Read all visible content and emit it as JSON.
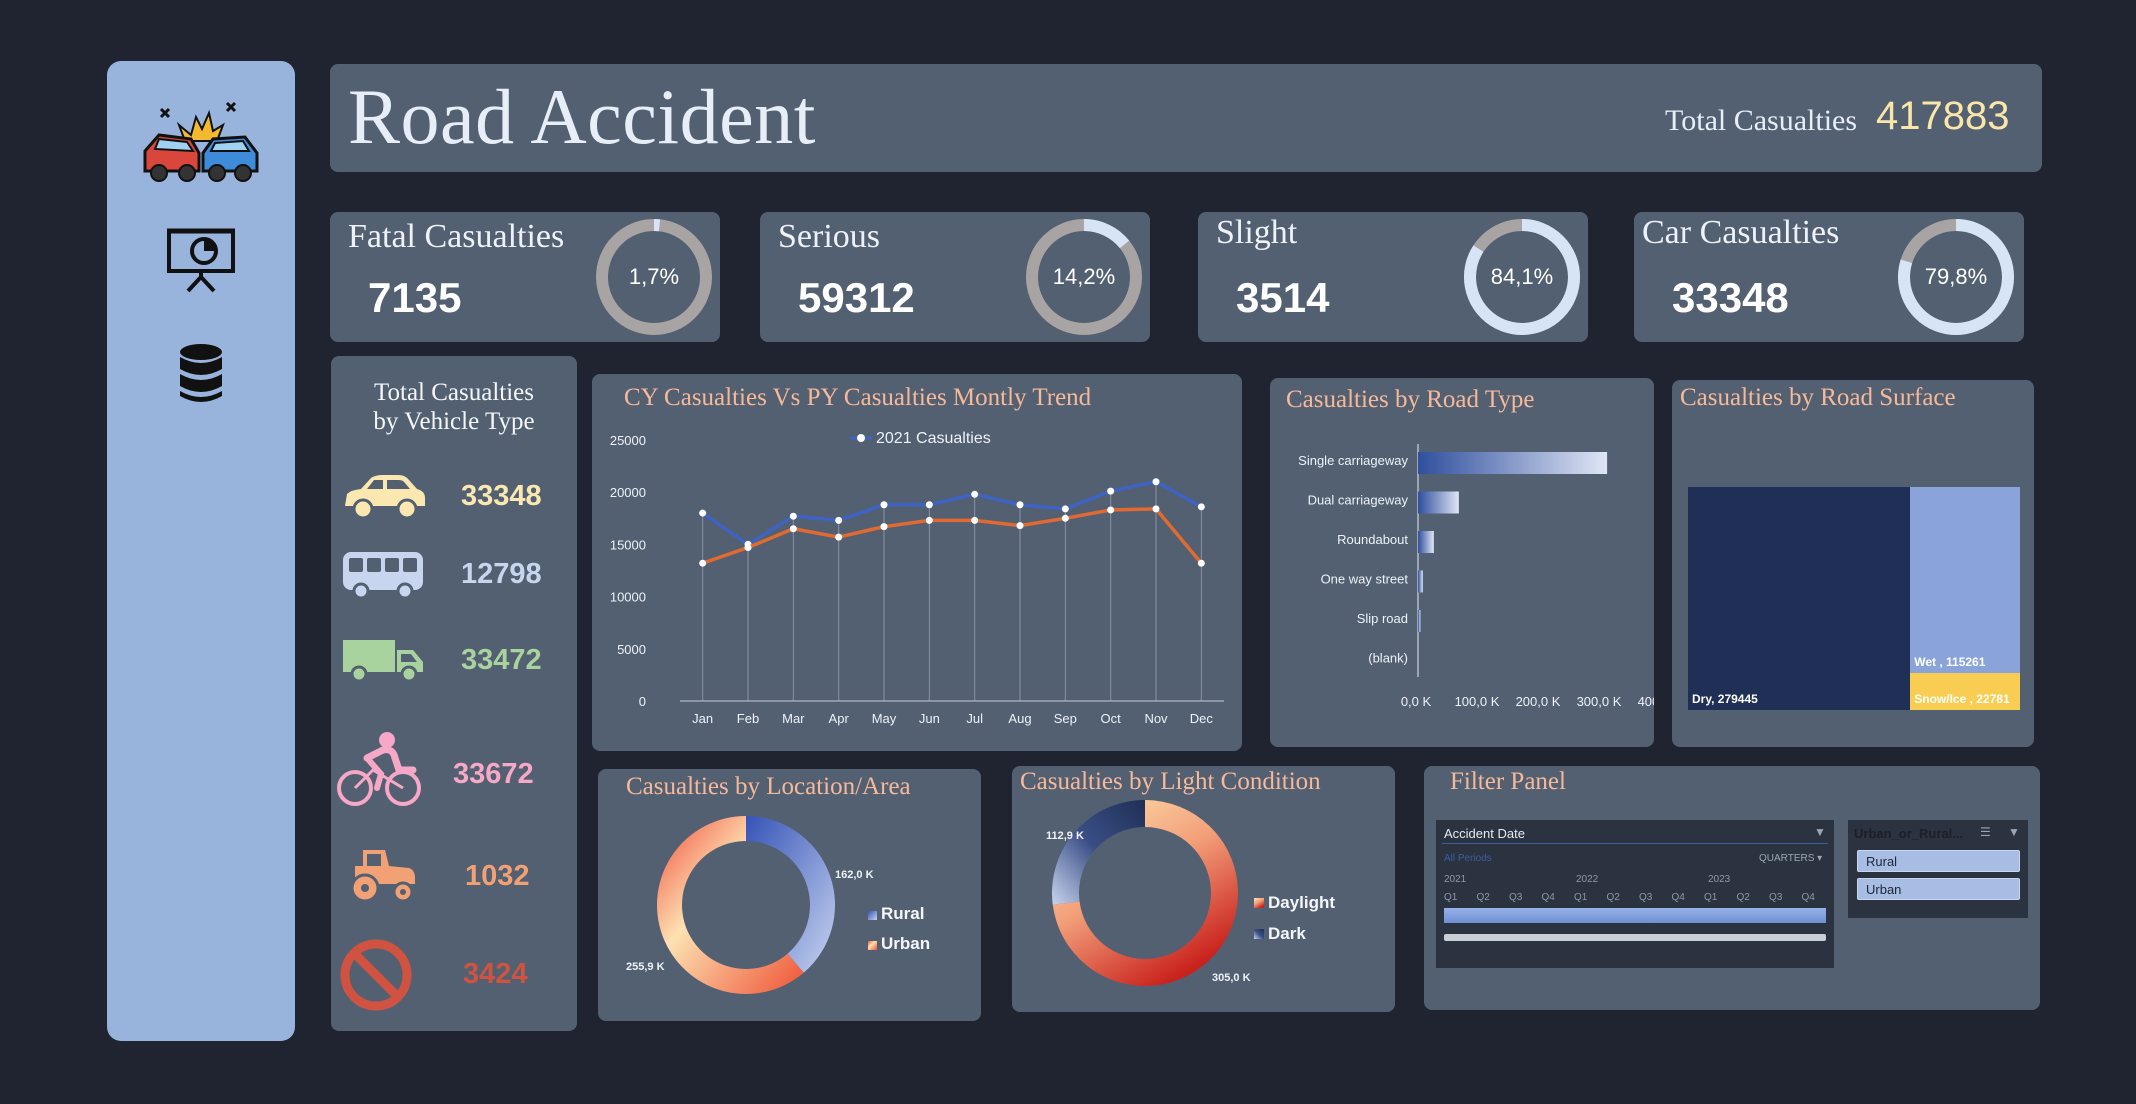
{
  "header": {
    "title": "Road Accident",
    "total_label": "Total Casualties",
    "total_value": "417883"
  },
  "kpis": [
    {
      "label": "Fatal Casualties",
      "value": "7135",
      "pct_label": "1,7%",
      "pct": 0.017
    },
    {
      "label": "Serious",
      "value": "59312",
      "pct_label": "14,2%",
      "pct": 0.142
    },
    {
      "label": "Slight",
      "value": "3514",
      "pct_label": "84,1%",
      "pct": 0.841
    },
    {
      "label": "Car Casualties",
      "value": "33348",
      "pct_label": "79,8%",
      "pct": 0.798
    }
  ],
  "vehicles": {
    "title_line1": "Total Casualties",
    "title_line2": "by Vehicle Type",
    "items": [
      {
        "icon": "car-icon",
        "value": "33348",
        "color": "#fbe8b0"
      },
      {
        "icon": "bus-icon",
        "value": "12798",
        "color": "#c7d6ee"
      },
      {
        "icon": "truck-icon",
        "value": "33472",
        "color": "#a9d39e"
      },
      {
        "icon": "bicycle-icon",
        "value": "33672",
        "color": "#f6a8c6"
      },
      {
        "icon": "tractor-icon",
        "value": "1032",
        "color": "#f2a174"
      },
      {
        "icon": "prohibited-icon",
        "value": "3424",
        "color": "#cf5340"
      }
    ]
  },
  "trend": {
    "title": "CY Casualties Vs PY Casualties Montly Trend",
    "chart_data": {
      "type": "line",
      "x": [
        "Jan",
        "Feb",
        "Mar",
        "Apr",
        "May",
        "Jun",
        "Jul",
        "Aug",
        "Sep",
        "Oct",
        "Nov",
        "Dec"
      ],
      "ylim": [
        0,
        25000
      ],
      "yticks": [
        "25000",
        "20000",
        "15000",
        "10000",
        "5000",
        "0"
      ],
      "series": [
        {
          "name": "2021 Casualties",
          "color": "#3e63c4",
          "values": [
            18000,
            15000,
            17700,
            17300,
            18800,
            18800,
            19800,
            18800,
            18400,
            20100,
            21000,
            18600
          ]
        },
        {
          "name": "",
          "color": "#e06a31",
          "values": [
            13200,
            14700,
            16500,
            15700,
            16700,
            17300,
            17300,
            16800,
            17500,
            18300,
            18400,
            13200
          ]
        }
      ]
    }
  },
  "roadtype": {
    "title": "Casualties by Road Type",
    "chart_data": {
      "type": "bar",
      "categories": [
        "Single carriageway",
        "Dual carriageway",
        "Roundabout",
        "One way street",
        "Slip road",
        "(blank)"
      ],
      "values": [
        310000,
        67000,
        26000,
        8000,
        4000,
        0
      ],
      "xticks": [
        "0,0 K",
        "100,0 K",
        "200,0 K",
        "300,0 K",
        "400,0 K"
      ],
      "xlim": [
        0,
        400000
      ]
    }
  },
  "surface": {
    "title": "Casualties by Road Surface",
    "chart_data": {
      "type": "treemap",
      "items": [
        {
          "label": "Dry, 279445",
          "value": 279445,
          "color": "#1f2f55"
        },
        {
          "label": "Wet , 115261",
          "value": 115261,
          "color": "#8aa4da"
        },
        {
          "label": "Snow/Ice , 22781",
          "value": 22781,
          "color": "#f8cd52"
        }
      ]
    }
  },
  "location": {
    "title": "Casualties by  Location/Area",
    "chart_data": {
      "type": "pie",
      "labels": [
        "Rural",
        "Urban"
      ],
      "values": [
        162000,
        255900
      ],
      "data_labels": [
        "162,0 K",
        "255,9 K"
      ]
    }
  },
  "light": {
    "title": "Casualties by Light Condition",
    "chart_data": {
      "type": "pie",
      "labels": [
        "Daylight",
        "Dark"
      ],
      "values": [
        305000,
        112900
      ],
      "data_labels": [
        "305,0 K",
        "112,9 K"
      ]
    }
  },
  "filter": {
    "title": "Filter Panel",
    "date_slicer": {
      "header": "Accident Date",
      "period_label": "All Periods",
      "level": "QUARTERS",
      "years": [
        "2021",
        "2022",
        "2023"
      ],
      "quarters": [
        "Q1",
        "Q2",
        "Q3",
        "Q4",
        "Q1",
        "Q2",
        "Q3",
        "Q4",
        "Q1",
        "Q2",
        "Q3",
        "Q4"
      ]
    },
    "area_slicer": {
      "header": "Urban_or_Rural...",
      "options": [
        "Rural",
        "Urban"
      ]
    }
  },
  "colors": {
    "background": "#1f2430",
    "panel": "#536071",
    "sidebar": "#99b4dc",
    "title_accent": "#f6b99a"
  }
}
